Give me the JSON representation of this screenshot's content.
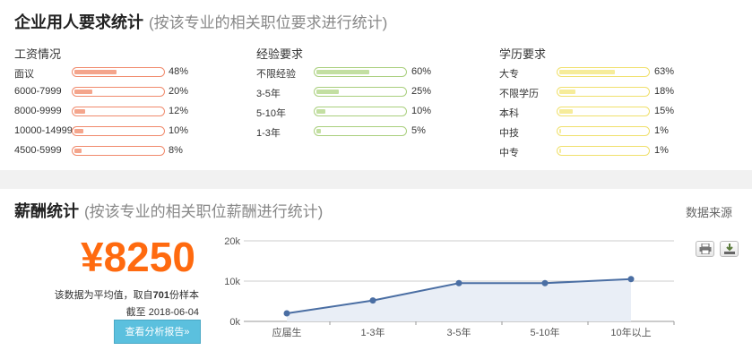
{
  "requirements": {
    "title": "企业用人要求统计",
    "subtitle": "(按该专业的相关职位要求进行统计)",
    "columns": [
      {
        "heading": "工资情况",
        "rows": [
          {
            "label": "面议",
            "percent": 48,
            "percent_text": "48%"
          },
          {
            "label": "6000-7999",
            "percent": 20,
            "percent_text": "20%"
          },
          {
            "label": "8000-9999",
            "percent": 12,
            "percent_text": "12%"
          },
          {
            "label": "10000-14999",
            "percent": 10,
            "percent_text": "10%"
          },
          {
            "label": "4500-5999",
            "percent": 8,
            "percent_text": "8%"
          }
        ]
      },
      {
        "heading": "经验要求",
        "rows": [
          {
            "label": "不限经验",
            "percent": 60,
            "percent_text": "60%"
          },
          {
            "label": "3-5年",
            "percent": 25,
            "percent_text": "25%"
          },
          {
            "label": "5-10年",
            "percent": 10,
            "percent_text": "10%"
          },
          {
            "label": "1-3年",
            "percent": 5,
            "percent_text": "5%"
          }
        ]
      },
      {
        "heading": "学历要求",
        "rows": [
          {
            "label": "大专",
            "percent": 63,
            "percent_text": "63%"
          },
          {
            "label": "不限学历",
            "percent": 18,
            "percent_text": "18%"
          },
          {
            "label": "本科",
            "percent": 15,
            "percent_text": "15%"
          },
          {
            "label": "中技",
            "percent": 1,
            "percent_text": "1%"
          },
          {
            "label": "中专",
            "percent": 1,
            "percent_text": "1%"
          }
        ]
      }
    ]
  },
  "salary": {
    "title": "薪酬统计",
    "subtitle": "(按该专业的相关职位薪酬进行统计)",
    "source_link": "数据来源",
    "average": "¥8250",
    "note_prefix": "该数据为平均值，取自",
    "sample_count": "701",
    "note_suffix": "份样本",
    "date_prefix": "截至",
    "date": "2018-06-04",
    "report_button": "查看分析报告»",
    "toolbar": {
      "print_icon": "printer-icon",
      "download_icon": "download-icon"
    }
  },
  "chart_data": {
    "type": "line",
    "categories": [
      "应届生",
      "1-3年",
      "3-5年",
      "5-10年",
      "10年以上"
    ],
    "values": [
      2000,
      5200,
      9500,
      9500,
      10500
    ],
    "ylim": [
      0,
      20000
    ],
    "yticks": [
      "0k",
      "10k",
      "20k"
    ],
    "grid": true,
    "line_color": "#4a6ea3",
    "fill_color": "#e9eef6"
  }
}
